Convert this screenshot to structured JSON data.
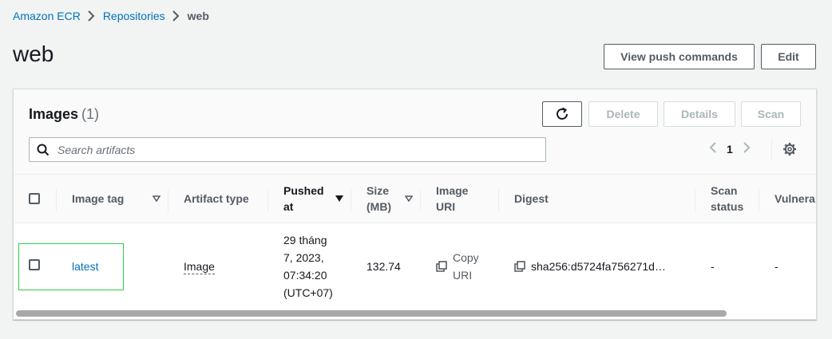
{
  "breadcrumb": {
    "items": [
      "Amazon ECR",
      "Repositories"
    ],
    "current": "web"
  },
  "page": {
    "title": "web",
    "view_push_label": "View push commands",
    "edit_label": "Edit"
  },
  "images_panel": {
    "title": "Images",
    "count": "(1)",
    "delete_label": "Delete",
    "details_label": "Details",
    "scan_label": "Scan",
    "search_placeholder": "Search artifacts",
    "page_number": "1"
  },
  "table": {
    "headers": {
      "image_tag": "Image tag",
      "artifact_type": "Artifact type",
      "pushed_at_1": "Pushed",
      "pushed_at_2": "at",
      "size_1": "Size",
      "size_2": "(MB)",
      "image_uri_1": "Image",
      "image_uri_2": "URI",
      "digest": "Digest",
      "scan_status_1": "Scan",
      "scan_status_2": "status",
      "vulnerabilities": "Vulnera"
    },
    "rows": [
      {
        "image_tag": "latest",
        "artifact_type": "Image",
        "pushed_at": [
          "29 tháng",
          "7, 2023,",
          "07:34:20",
          "(UTC+07)"
        ],
        "size_mb": "132.74",
        "image_uri_1": "Copy",
        "image_uri_2": "URI",
        "digest": "sha256:d5724fa756271d…",
        "scan_status": "-",
        "vulnerabilities": "-"
      }
    ]
  },
  "icons": [
    "chevron-right-icon",
    "refresh-icon",
    "search-icon",
    "chevron-left-icon",
    "gear-icon",
    "sort-caret-icon",
    "copy-icon"
  ],
  "colors": {
    "link": "#0073bb",
    "highlight": "#33cc44",
    "text": "#16191f"
  }
}
